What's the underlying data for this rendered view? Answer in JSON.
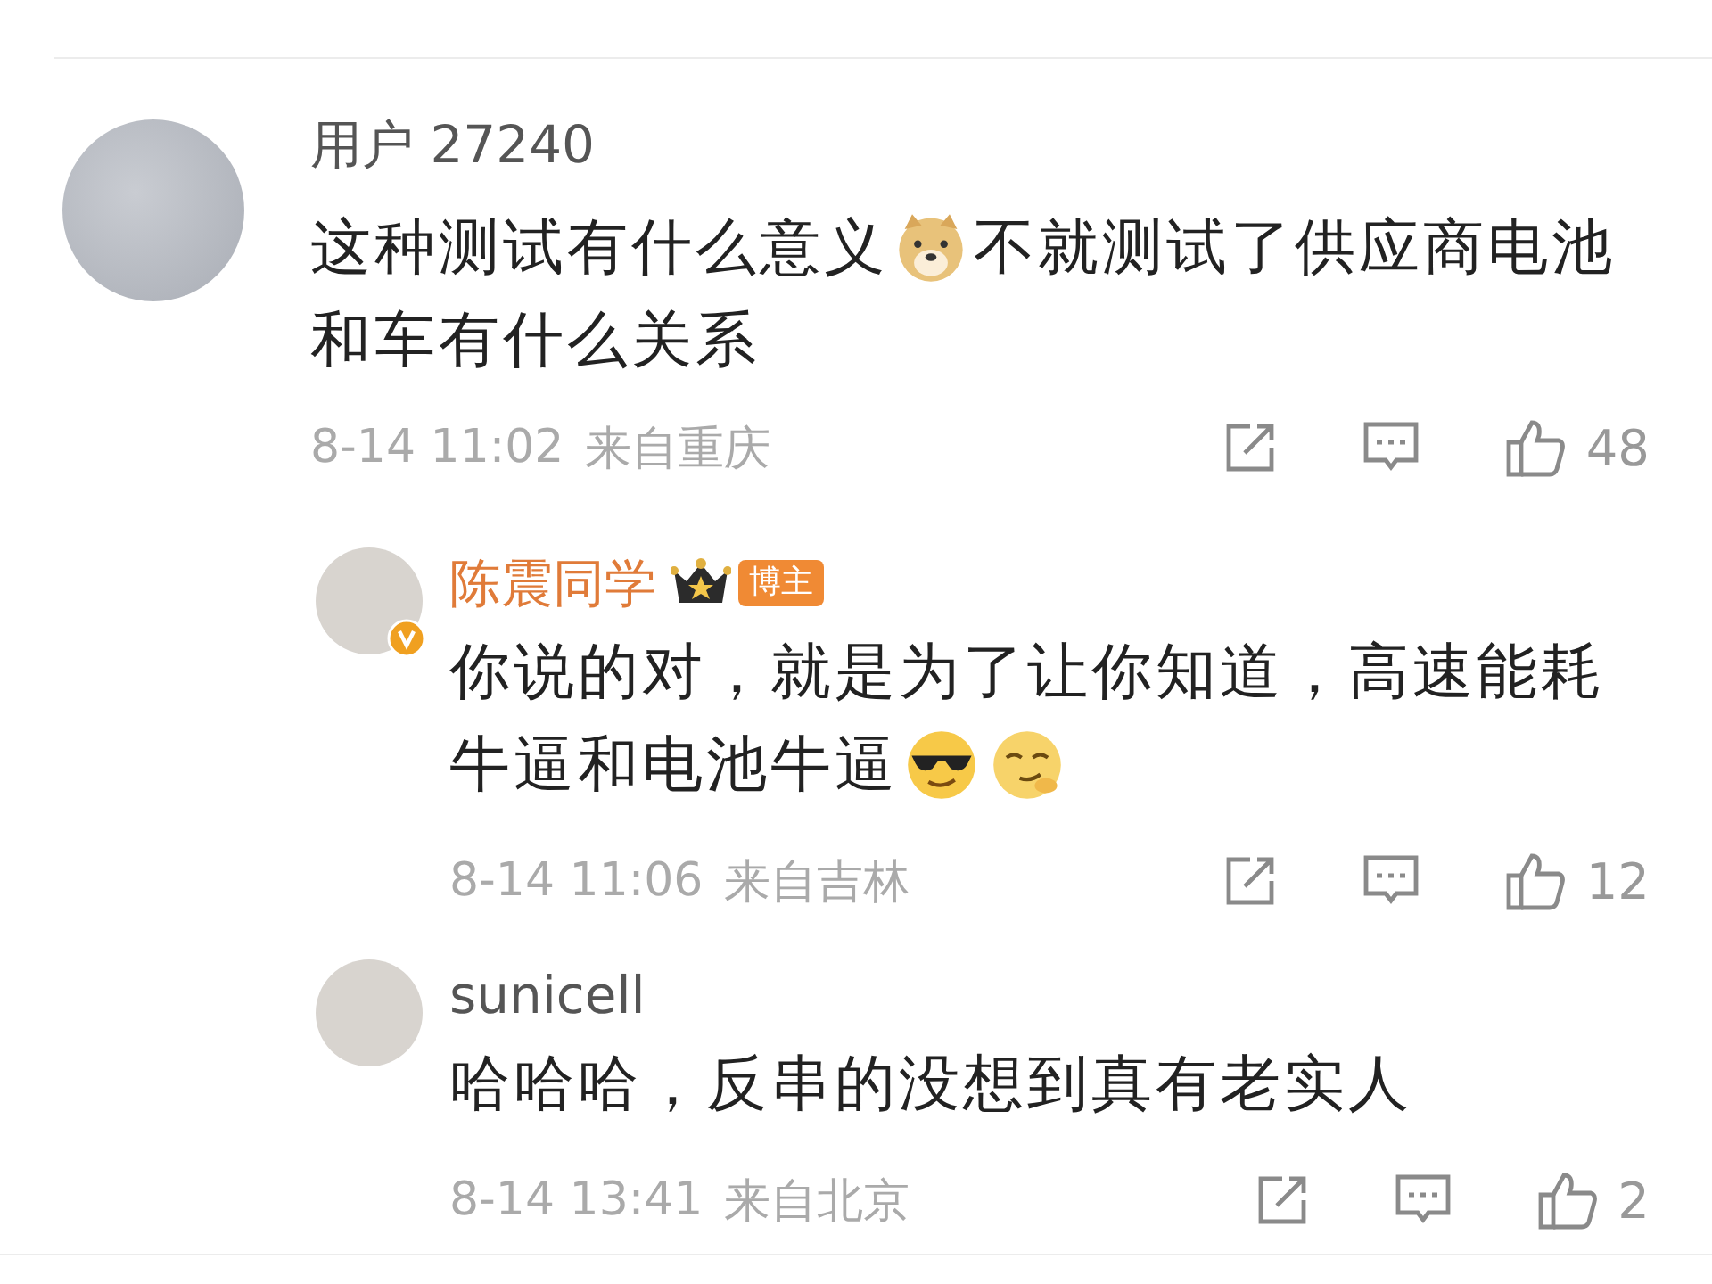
{
  "comments": [
    {
      "name": "用户 27240",
      "author": false,
      "lines": [
        [
          {
            "kind": "text",
            "text": "这种测试有什么意义"
          },
          {
            "kind": "doge"
          },
          {
            "kind": "text",
            "text": "不就测试了供应商电池"
          }
        ],
        [
          {
            "kind": "text",
            "text": "和车有什么关系"
          }
        ]
      ],
      "time": "8-14 11:02",
      "location": "来自重庆",
      "likes": "48",
      "replies": [
        {
          "name": "陈震同学",
          "author": true,
          "verified": true,
          "badge": "博主",
          "lines": [
            [
              {
                "kind": "text",
                "text": "你说的对，就是为了让你知道，高速能耗"
              }
            ],
            [
              {
                "kind": "text",
                "text": "牛逼和电池牛逼"
              },
              {
                "kind": "cool"
              },
              {
                "kind": "smirk"
              }
            ]
          ],
          "time": "8-14 11:06",
          "location": "来自吉林",
          "likes": "12"
        },
        {
          "name": "sunicell",
          "author": false,
          "verified": false,
          "lines": [
            [
              {
                "kind": "text",
                "text": "哈哈哈，反串的没想到真有老实人"
              }
            ]
          ],
          "time": "8-14 13:41",
          "location": "来自北京",
          "likes": "2"
        }
      ]
    }
  ]
}
